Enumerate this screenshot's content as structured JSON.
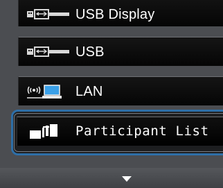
{
  "menu": {
    "items": [
      {
        "label": "USB Display",
        "icon": "usb-display-icon"
      },
      {
        "label": "USB",
        "icon": "usb-icon"
      },
      {
        "label": "LAN",
        "icon": "lan-icon"
      },
      {
        "label": "Participant List",
        "icon": "participant-list-icon",
        "selected": true
      }
    ],
    "scroll_icon": "chevron-down-icon"
  },
  "colors": {
    "background": "#4b4d51",
    "item_background": "#0b0b0b",
    "selection_border": "#2e6fa8",
    "text": "#ffffff"
  }
}
